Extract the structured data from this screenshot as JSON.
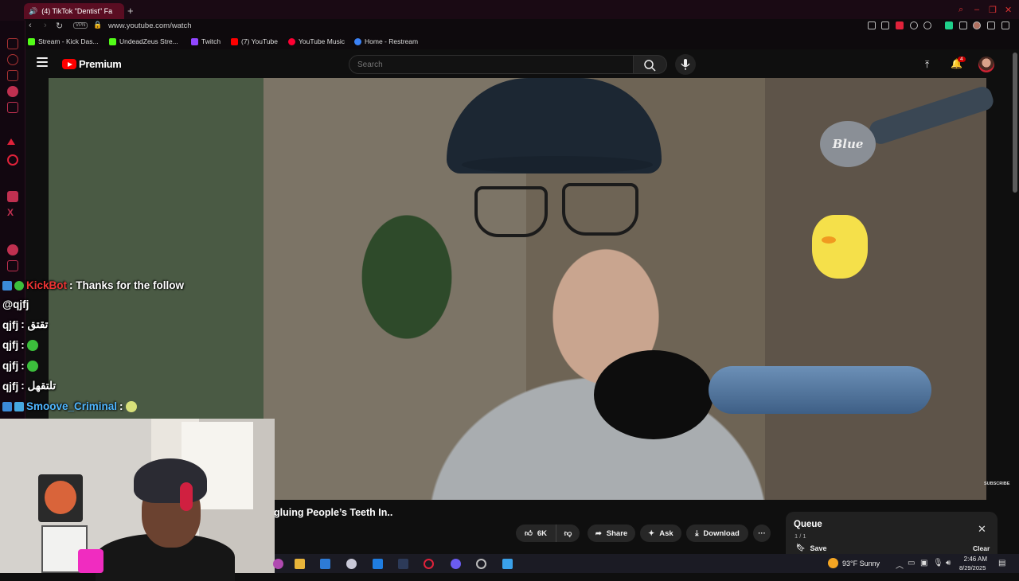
{
  "browser": {
    "tab_title": "(4) TikTok \"Dentist\" Fa",
    "new_tab": "+",
    "vpn_label": "VPN",
    "url": "www.youtube.com/watch",
    "bookmarks": [
      {
        "label": "Stream - Kick Das...",
        "color": "#53fc18"
      },
      {
        "label": "UndeadZeus Stre...",
        "color": "#53fc18"
      },
      {
        "label": "Twitch",
        "color": "#9146ff"
      },
      {
        "label": "(7) YouTube",
        "color": "#ff0000"
      },
      {
        "label": "YouTube Music",
        "color": "#ff0033"
      },
      {
        "label": "Home - Restream",
        "color": "#3b82f6"
      }
    ]
  },
  "youtube": {
    "logo_text": "Premium",
    "search_placeholder": "Search",
    "notification_count": "4",
    "video_title": "gluing People’s Teeth In..",
    "watermark": "SUBSCRIBE",
    "mic_brand": "Blue",
    "actions": {
      "like_count": "6K",
      "share": "Share",
      "ask": "Ask",
      "download": "Download",
      "more": "···"
    },
    "queue": {
      "title": "Queue",
      "count": "1 / 1",
      "save": "Save",
      "clear": "Clear",
      "close": "✕"
    }
  },
  "chat": [
    {
      "user": "KickBot",
      "message": ": Thanks for the follow",
      "user_color": "red"
    },
    {
      "user": "@qjfj",
      "message": "",
      "user_color": "white"
    },
    {
      "user": "qjfj",
      "message": ": تقتق",
      "user_color": "white"
    },
    {
      "user": "qjfj",
      "message": ":",
      "user_color": "white"
    },
    {
      "user": "qjfj",
      "message": ":",
      "user_color": "white"
    },
    {
      "user": "qjfj",
      "message": ": تلتقهل",
      "user_color": "white"
    },
    {
      "user": "Smoove_Criminal",
      "message": ":",
      "user_color": "blue"
    }
  ],
  "taskbar": {
    "weather": "93°F  Sunny",
    "time": "2:46 AM",
    "date": "8/29/2025"
  }
}
